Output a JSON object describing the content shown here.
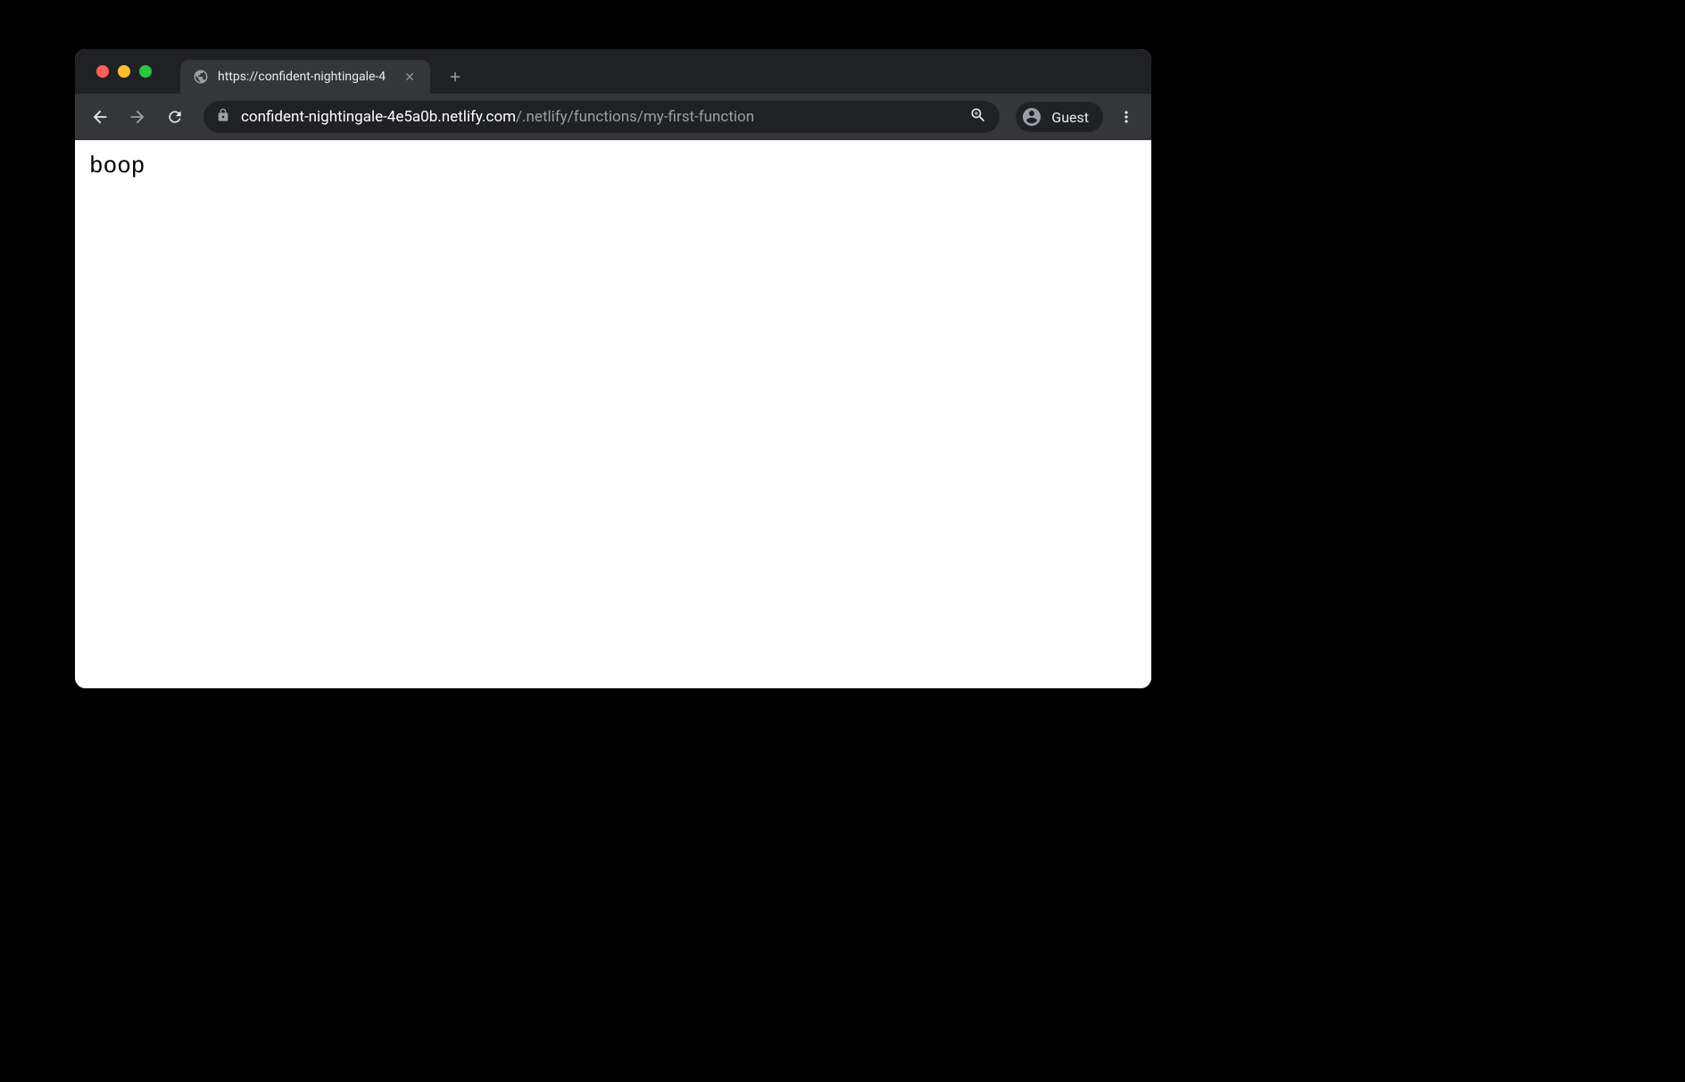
{
  "tab": {
    "title": "https://confident-nightingale-4"
  },
  "addressBar": {
    "host": "confident-nightingale-4e5a0b.netlify.com",
    "path": "/.netlify/functions/my-first-function"
  },
  "profile": {
    "label": "Guest"
  },
  "page": {
    "body": "boop"
  }
}
